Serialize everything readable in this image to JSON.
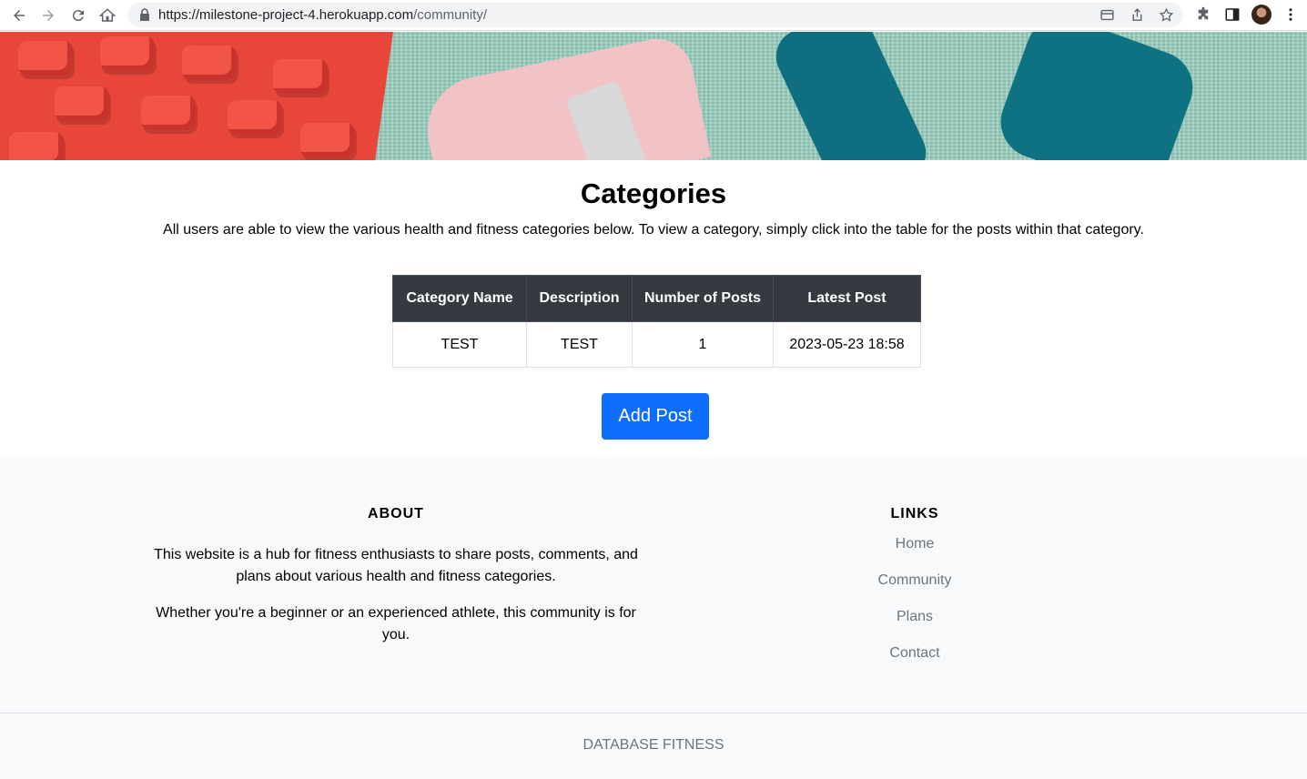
{
  "browser": {
    "url_host": "https://milestone-project-4.herokuapp.com",
    "url_path": "/community/"
  },
  "page": {
    "title": "Categories",
    "intro": "All users are able to view the various health and fitness categories below. To view a category, simply click into the table for the posts within that category."
  },
  "table": {
    "headers": [
      "Category Name",
      "Description",
      "Number of Posts",
      "Latest Post"
    ],
    "rows": [
      [
        "TEST",
        "TEST",
        "1",
        "2023-05-23 18:58"
      ]
    ]
  },
  "add_post_label": "Add Post",
  "footer": {
    "about_heading": "ABOUT",
    "about_p1": "This website is a hub for fitness enthusiasts to share posts, comments, and plans about various health and fitness categories.",
    "about_p2": "Whether you're a beginner or an experienced athlete, this community is for you.",
    "links_heading": "LINKS",
    "links": [
      "Home",
      "Community",
      "Plans",
      "Contact"
    ],
    "copyright": "DATABASE FITNESS"
  },
  "colors": {
    "primary_button": "#0d6efd",
    "table_header": "#343a40",
    "footer_bg": "#f8f9fa",
    "muted_text": "#6c757d"
  },
  "icons": [
    "back-icon",
    "forward-icon",
    "reload-icon",
    "home-icon",
    "lock-icon",
    "tab-search-icon",
    "share-icon",
    "bookmark-star-icon",
    "extensions-icon",
    "side-panel-icon",
    "more-menu-icon"
  ]
}
